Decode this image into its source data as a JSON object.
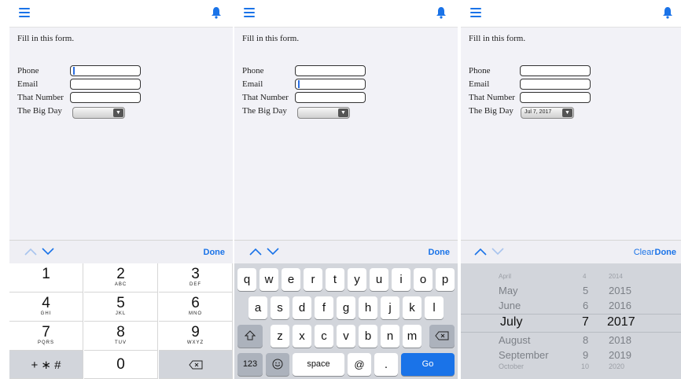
{
  "form": {
    "intro": "Fill in this form.",
    "phone_label": "Phone",
    "email_label": "Email",
    "number_label": "That Number",
    "bigday_label": "The Big Day",
    "bigday_value": "Jul 7, 2017"
  },
  "toolbar": {
    "done_label": "Done",
    "clear_label": "Clear"
  },
  "numpad": {
    "keys": [
      {
        "digit": "1",
        "letters": ""
      },
      {
        "digit": "2",
        "letters": "ABC"
      },
      {
        "digit": "3",
        "letters": "DEF"
      },
      {
        "digit": "4",
        "letters": "GHI"
      },
      {
        "digit": "5",
        "letters": "JKL"
      },
      {
        "digit": "6",
        "letters": "MNO"
      },
      {
        "digit": "7",
        "letters": "PQRS"
      },
      {
        "digit": "8",
        "letters": "TUV"
      },
      {
        "digit": "9",
        "letters": "WXYZ"
      }
    ],
    "symbols": "+ ∗ #",
    "zero": "0"
  },
  "keyboard": {
    "row1": [
      "q",
      "w",
      "e",
      "r",
      "t",
      "y",
      "u",
      "i",
      "o",
      "p"
    ],
    "row2": [
      "a",
      "s",
      "d",
      "f",
      "g",
      "h",
      "j",
      "k",
      "l"
    ],
    "row3": [
      "z",
      "x",
      "c",
      "v",
      "b",
      "n",
      "m"
    ],
    "numbers_label": "123",
    "space_label": "space",
    "at_label": "@",
    "dot_label": ".",
    "go_label": "Go"
  },
  "picker": {
    "rows": [
      {
        "month": "April",
        "day": "4",
        "year": "2014"
      },
      {
        "month": "May",
        "day": "5",
        "year": "2015"
      },
      {
        "month": "June",
        "day": "6",
        "year": "2016"
      },
      {
        "month": "July",
        "day": "7",
        "year": "2017"
      },
      {
        "month": "August",
        "day": "8",
        "year": "2018"
      },
      {
        "month": "September",
        "day": "9",
        "year": "2019"
      },
      {
        "month": "October",
        "day": "10",
        "year": "2020"
      }
    ]
  },
  "colors": {
    "accent": "#1a73e8",
    "keyboard_bg": "#d2d5db",
    "form_bg": "#f2f2f7"
  }
}
